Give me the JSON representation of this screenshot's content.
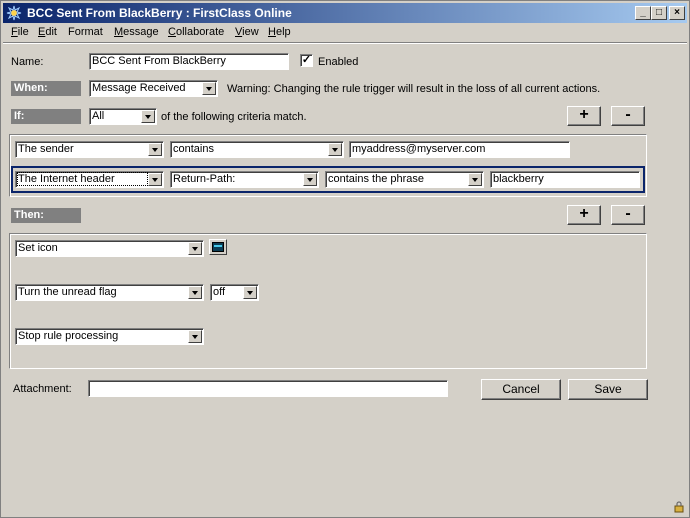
{
  "window": {
    "title": "BCC Sent From BlackBerry : FirstClass Online",
    "minimize_glyph": "_",
    "maximize_glyph": "□",
    "close_glyph": "×"
  },
  "menu": [
    {
      "key": "F",
      "rest": "ile"
    },
    {
      "key": "E",
      "rest": "dit"
    },
    {
      "key": "",
      "rest": "Format"
    },
    {
      "key": "M",
      "rest": "essage"
    },
    {
      "key": "C",
      "rest": "ollaborate"
    },
    {
      "key": "V",
      "rest": "iew"
    },
    {
      "key": "H",
      "rest": "elp"
    }
  ],
  "name_row": {
    "label": "Name:",
    "value": "BCC Sent From BlackBerry",
    "enabled_label": "Enabled",
    "enabled_checked": "✓"
  },
  "when_row": {
    "tag": "When:",
    "trigger": "Message Received",
    "warning": "Warning:  Changing the rule trigger will result in the loss of all current actions."
  },
  "if_row": {
    "tag": "If:",
    "match": "All",
    "suffix": "of the following criteria match.",
    "add_label": "+",
    "remove_label": "-"
  },
  "criteria": [
    {
      "field": "The sender",
      "operator": "contains",
      "value": "myaddress@myserver.com"
    },
    {
      "field": "The Internet header",
      "header": "Return-Path:",
      "operator": "contains the phrase",
      "value": "blackberry"
    }
  ],
  "then_row": {
    "tag": "Then:",
    "add_label": "+",
    "remove_label": "-"
  },
  "actions": [
    {
      "action": "Set icon",
      "icon": "terminal-icon"
    },
    {
      "action": "Turn the unread flag",
      "option": "off"
    },
    {
      "action": "Stop rule processing"
    }
  ],
  "footer": {
    "attachment_label": "Attachment:",
    "attachment_value": "",
    "cancel_label": "Cancel",
    "save_label": "Save"
  },
  "colors": {
    "titlebar_start": "#0a246a",
    "titlebar_end": "#a6caf0",
    "face": "#d4d0c8",
    "section_tag": "#808080"
  }
}
